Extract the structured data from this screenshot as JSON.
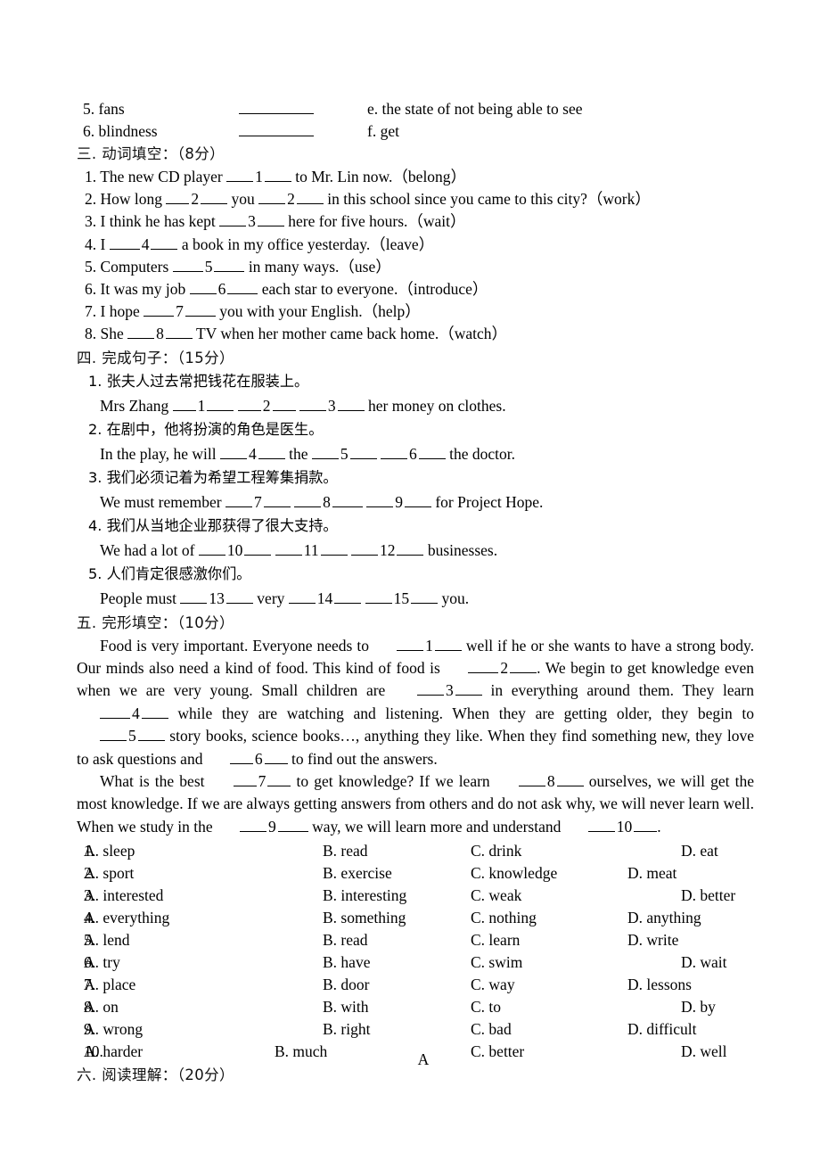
{
  "document": {
    "page_mark": "A"
  },
  "matching": {
    "items": [
      {
        "num": "5.",
        "term": "fans",
        "def": "e. the state of not being able to see"
      },
      {
        "num": "6.",
        "term": "blindness",
        "def": "f. get"
      }
    ]
  },
  "section3": {
    "heading": "三. 动词填空：（8分）",
    "questions": [
      {
        "num": "1.",
        "before": "The new CD player",
        "blank": "1",
        "after": "to Mr. Lin now.（belong）"
      },
      {
        "num": "2.",
        "before": "How long",
        "blank": "2",
        "mid": "you",
        "blank2": "2",
        "after": "in this school since you came to this city?（work）"
      },
      {
        "num": "3.",
        "before": "I think he has kept",
        "blank": "3",
        "after": "here for five hours.（wait）"
      },
      {
        "num": "4.",
        "before": "I",
        "blank": "4",
        "after": "a book in my office yesterday.（leave）"
      },
      {
        "num": "5.",
        "before": "Computers",
        "blank": "5",
        "after": "in many ways.（use）"
      },
      {
        "num": "6.",
        "before": "It was my job",
        "blank": "6",
        "after": "each star to everyone.（introduce）"
      },
      {
        "num": "7.",
        "before": "I hope",
        "blank": "7",
        "after": "you with your English.（help）"
      },
      {
        "num": "8.",
        "before": "She",
        "blank": "8",
        "after": "TV when her mother came back home.（watch）"
      }
    ]
  },
  "section4": {
    "heading": "四. 完成句子：（15分）",
    "items": [
      {
        "num": "1.",
        "cn": "张夫人过去常把钱花在服装上。",
        "en_before": "Mrs Zhang",
        "blanks": [
          "1",
          "2",
          "3"
        ],
        "en_after": "her money on clothes."
      },
      {
        "num": "2.",
        "cn": "在剧中，他将扮演的角色是医生。",
        "en_before": "In the play, he will",
        "blanks": [
          "4",
          "5",
          "6"
        ],
        "en_mid": "the",
        "en_after": "the doctor."
      },
      {
        "num": "3.",
        "cn": "我们必须记着为希望工程筹集捐款。",
        "en_before": "We must remember",
        "blanks": [
          "7",
          "8",
          "9"
        ],
        "en_after": "for Project Hope."
      },
      {
        "num": "4.",
        "cn": "我们从当地企业那获得了很大支持。",
        "en_before": "We had a lot of",
        "blanks": [
          "10",
          "11",
          "12"
        ],
        "en_after": "businesses."
      },
      {
        "num": "5.",
        "cn": "人们肯定很感激你们。",
        "en_before": "People must",
        "blanks": [
          "13",
          "14",
          "15"
        ],
        "en_mid": "very",
        "en_after": "you."
      }
    ]
  },
  "section5": {
    "heading": "五. 完形填空：（10分）",
    "passage": {
      "p1_a": "Food is very important. Everyone needs to",
      "b1": "1",
      "p1_b": "well if he or she wants to have a strong body. Our minds also need a kind of food. This kind of food is",
      "b2": "2",
      "p1_c": ". We begin to get knowledge even when we are very young. Small children are",
      "b3": "3",
      "p1_d": "in everything around them. They learn",
      "b4": "4",
      "p1_e": "while they are watching and listening. When they are getting older, they begin to",
      "b5": "5",
      "p1_f": "story books, science books…, anything they like. When they find something new, they love to ask questions and",
      "b6": "6",
      "p1_g": "to find out the answers.",
      "p2_a": "What is the best",
      "b7": "7",
      "p2_b": "to get knowledge? If we learn",
      "b8": "8",
      "p2_c": "ourselves, we will get the most knowledge. If we are always getting answers from others and do not ask why, we will never learn well. When we study in the",
      "b9": "9",
      "p2_d": "way, we will learn more and understand",
      "b10": "10",
      "p2_e": "."
    },
    "options": [
      {
        "n": "1.",
        "a": "A. sleep",
        "b": "B. read",
        "c": "C. drink",
        "d": "D. eat",
        "d_far": true,
        "b_near": false
      },
      {
        "n": "2.",
        "a": "A. sport",
        "b": "B. exercise",
        "c": "C. knowledge",
        "d": "D. meat",
        "d_far": false,
        "b_near": false
      },
      {
        "n": "3.",
        "a": "A. interested",
        "b": "B. interesting",
        "c": "C. weak",
        "d": "D. better",
        "d_far": true,
        "b_near": false
      },
      {
        "n": "4.",
        "a": "A. everything",
        "b": "B. something",
        "c": "C. nothing",
        "d": "D. anything",
        "d_far": false,
        "b_near": false
      },
      {
        "n": "5.",
        "a": "A. lend",
        "b": "B. read",
        "c": "C. learn",
        "d": "D. write",
        "d_far": false,
        "b_near": false
      },
      {
        "n": "6.",
        "a": "A. try",
        "b": "B. have",
        "c": "C. swim",
        "d": "D. wait",
        "d_far": true,
        "b_near": false
      },
      {
        "n": "7.",
        "a": "A. place",
        "b": "B. door",
        "c": "C. way",
        "d": "D. lessons",
        "d_far": false,
        "b_near": false
      },
      {
        "n": "8.",
        "a": "A. on",
        "b": "B. with",
        "c": "C. to",
        "d": "D. by",
        "d_far": true,
        "b_near": false
      },
      {
        "n": "9.",
        "a": "A. wrong",
        "b": "B. right",
        "c": "C. bad",
        "d": "D. difficult",
        "d_far": false,
        "b_near": false
      },
      {
        "n": "10.",
        "a": "A. harder",
        "b": "B. much",
        "c": "C. better",
        "d": "D. well",
        "d_far": true,
        "b_near": true
      }
    ]
  },
  "section6": {
    "heading": "六. 阅读理解：（20分）"
  }
}
